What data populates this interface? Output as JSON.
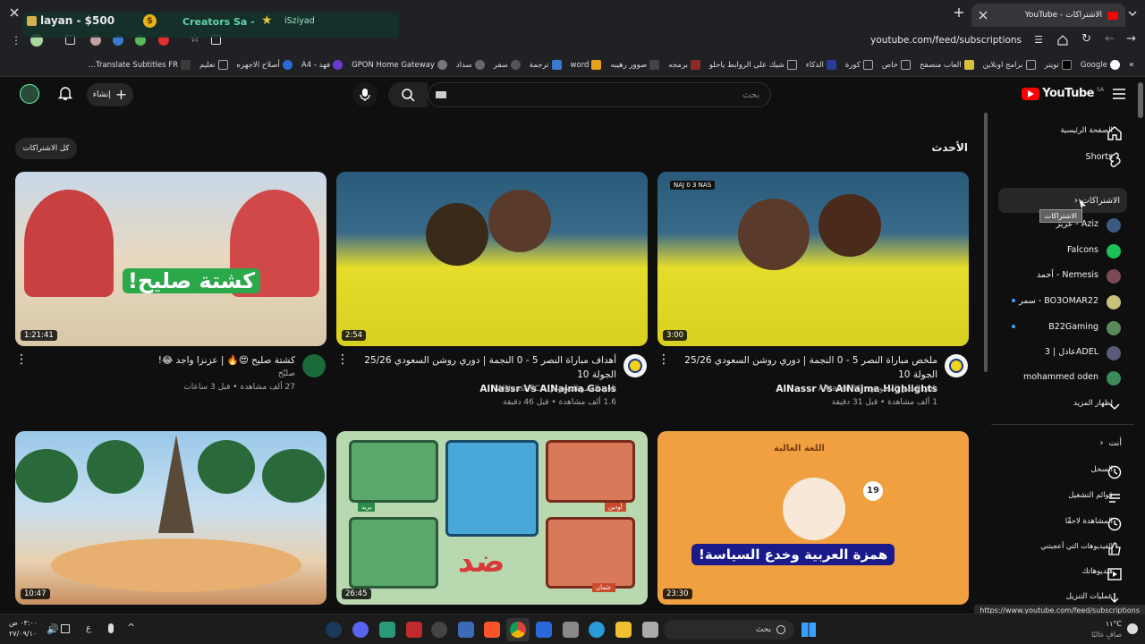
{
  "browser": {
    "tab_title": "YouTube - الاشتراكات",
    "url": "youtube.com/feed/subscriptions",
    "status_url": "https://www.youtube.com/feed/subscriptions",
    "overlay_left": "layan - $500",
    "overlay_mid": "Creators Sa - ",
    "overlay_right": "iSziyad",
    "bookmarks": [
      "Google",
      "تويتر",
      "برامج اونلاين",
      "العاب متصفح",
      "خاص",
      "كورة",
      "الذكاء",
      "شيك على الروابط ياحلو",
      "برمجه",
      "صوور رهيبه",
      "word",
      "ترجمة",
      "سفر",
      "سداد",
      "GPON Home Gateway",
      "فهد - A4",
      "أصلاح الاجهزه",
      "تعليم",
      "Translate Subtitles FR..."
    ]
  },
  "yt": {
    "logo": "YouTube",
    "region": "SA",
    "search_placeholder": "بحث",
    "create_label": "إنشاء",
    "section_title": "الأحدث",
    "all_subs_button": "كل الاشتراكات"
  },
  "sidebar": {
    "home": "الصفحة الرئيسية",
    "shorts": "Shorts",
    "subscriptions": "الاشتراكات",
    "tooltip": "الاشتراكات",
    "channels": [
      {
        "name": "عزيز - Aziz",
        "color": "#3a5a80"
      },
      {
        "name": "Falcons",
        "color": "#1fbf5a"
      },
      {
        "name": "أحمد - Nemesis",
        "color": "#7a4a55"
      },
      {
        "name": "سمر - BO3OMAR22",
        "color": "#c9c27a"
      },
      {
        "name": "B22Gaming",
        "color": "#5a8a5a"
      },
      {
        "name": "عادل | 3ADEL",
        "color": "#5a5a7a"
      },
      {
        "name": "mohammed oden",
        "color": "#3a8a5a"
      }
    ],
    "show_more": "إظهار المزيد",
    "you": "أنت",
    "history": "السجل",
    "playlists": "قوائم التشغيل",
    "watch_later": "المشاهدة لاحقًا",
    "liked": "الفيديوهات التي أعجبتني",
    "your_videos": "فيديوهاتك",
    "downloads": "عمليات التنزيل"
  },
  "videos": [
    {
      "title1": "ملخص مباراة النصر 5 - 0 النجمة | دوري روشن السعودي 25/26 الجولة 10",
      "title2": "AlNassr Vs AlNajma Highlights",
      "channel": "نادي النصر السعودي - AlNassr FC",
      "meta": "1 ألف مشاهدة • قبل 31 دقيقة",
      "duration": "3:00",
      "score": "NAJ 0 3 NAS"
    },
    {
      "title1": "أهداف مباراة النصر 5 - 0 النجمة | دوري روشن السعودي 25/26 الجولة 10",
      "title2": "AlNassr Vs AlNajma Goals",
      "channel": "نادي النصر السعودي - AlNassr FC",
      "meta": "1.6 ألف مشاهدة • قبل 46 دقيقة",
      "duration": "2:54"
    },
    {
      "title1": "كشتة صليح 😍🔥 | عزنزا واجد 😂!",
      "title2": "",
      "channel": "صليّح",
      "meta": "27 ألف مشاهدة • قبل 3 ساعات",
      "duration": "1:21:41",
      "overlay": "كشتة صليح!"
    },
    {
      "duration": "23:30",
      "overlay": "همزة العربية وخدع السياسة!",
      "badge": "19",
      "headline": "اللغة العالية"
    },
    {
      "duration": "26:45",
      "overlay": "ضد",
      "names": [
        "يزيد",
        "أودين",
        "عثمان"
      ]
    },
    {
      "duration": "10:47"
    }
  ],
  "taskbar": {
    "search": "بحث",
    "weather": "١١°C",
    "weather_sub": "صافٍ غالبًا",
    "time": "٠٣:٠٠ ص",
    "date": "٢٧/٠٩/١٠"
  }
}
